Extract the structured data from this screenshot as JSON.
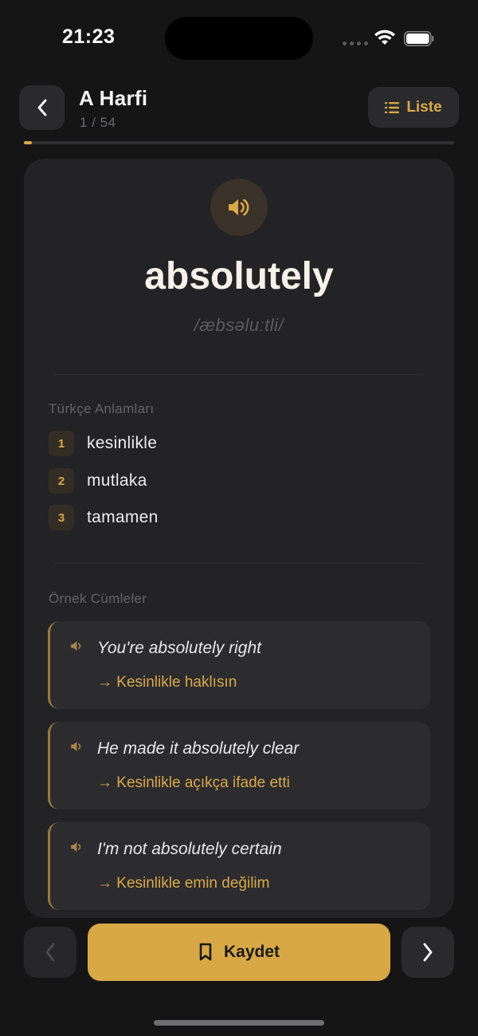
{
  "status_bar": {
    "time": "21:23"
  },
  "header": {
    "title": "A Harfi",
    "counter": "1 / 54",
    "list_label": "Liste",
    "progress": 0.0185
  },
  "card": {
    "word": "absolutely",
    "phonetic": "/æbsəluːtli/",
    "meanings_label": "Türkçe Anlamları",
    "meanings": [
      {
        "num": "1",
        "text": "kesinlikle"
      },
      {
        "num": "2",
        "text": "mutlaka"
      },
      {
        "num": "3",
        "text": "tamamen"
      }
    ],
    "examples_label": "Örnek Cümleler",
    "examples": [
      {
        "en": "You're absolutely right",
        "tr": "→ Kesinlikle haklısın"
      },
      {
        "en": "He made it absolutely clear",
        "tr": "→ Kesinlikle açıkça ifade etti"
      },
      {
        "en": "I'm not absolutely certain",
        "tr": "→ Kesinlikle emin değilim"
      }
    ]
  },
  "bottom_nav": {
    "save_label": "Kaydet"
  },
  "colors": {
    "accent": "#d9a848",
    "background": "#151516",
    "card": "#232326"
  },
  "icons": {
    "back": "chevron-left-icon",
    "list": "list-icon",
    "speaker": "speaker-icon",
    "bookmark": "bookmark-icon",
    "prev": "chevron-left-icon",
    "next": "chevron-right-icon"
  }
}
